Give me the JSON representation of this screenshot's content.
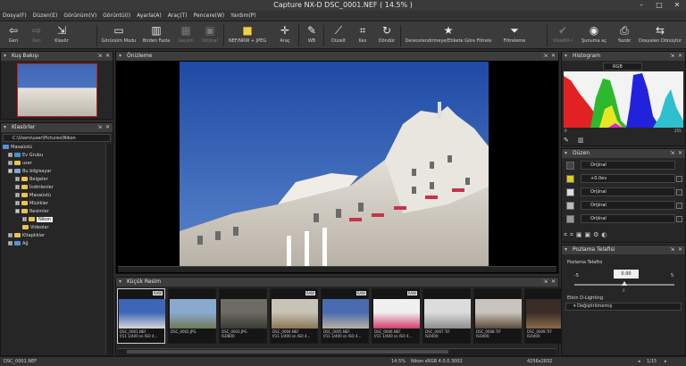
{
  "window": {
    "title": "Capture NX-D     DSC_0001.NEF ( 14.5% )"
  },
  "menu": [
    "Dosya(F)",
    "Düzen(E)",
    "Görünüm(V)",
    "Görüntü(I)",
    "Ayarla(A)",
    "Araç(T)",
    "Pencere(W)",
    "Yardım(P)"
  ],
  "toolbar": {
    "back": "Geri",
    "forward": "İleri",
    "browse": "Klasör",
    "view_mode": "Görünüm Modu",
    "multi": "Birden Fazla",
    "revert": "Geçerli",
    "original": "Orijinal",
    "nef_jpeg": "NEF/NRW + JPEG",
    "tool": "Araç",
    "wb": "WB",
    "straighten": "Düzelt",
    "crop": "Kes",
    "rotate": "Döndür",
    "rating_filter": "Derecelendirmeye/Etikete Göre Filtrele",
    "filter": "Filtreleme",
    "viewnx": "ViewNX-i",
    "surrounding": "Şunuma aç",
    "print": "Yazdır",
    "convert": "Dosyaları Dönüştür"
  },
  "overview": {
    "title": "Kuş Bakışı"
  },
  "folders": {
    "title": "Klasörler",
    "path": "C:\\Users\\user\\Pictures\\Nikon",
    "tree": [
      "Masaüstü",
      "Ev Grubu",
      "user",
      "Bu bilgisayar",
      "Belgeler",
      "İndirilenler",
      "Masaüstü",
      "Müzikler",
      "Resimler",
      "Nikon",
      "Videolar",
      "Kitaplıklar",
      "Ağ"
    ]
  },
  "viewer": {
    "title": "Önizleme"
  },
  "thumbnails": {
    "title": "Küçük Resim",
    "items": [
      {
        "name": "DSC_0001.NEF",
        "meta": "f/11 1/400 sn ISO 4...",
        "raw": "RAW",
        "colors": [
          "#3d66b8",
          "#d8d8d8"
        ]
      },
      {
        "name": "DSC_0002.JPG",
        "meta": "",
        "raw": "",
        "colors": [
          "#8aa9cf",
          "#6f7a58"
        ]
      },
      {
        "name": "DSC_0003.JPG",
        "meta": "ISO800",
        "raw": "",
        "colors": [
          "#6e6a64",
          "#3a3a38"
        ]
      },
      {
        "name": "DSC_0004.NEF",
        "meta": "f/11 1/400 sn ISO 4...",
        "raw": "RAW",
        "colors": [
          "#c7c3b6",
          "#8a7656"
        ]
      },
      {
        "name": "DSC_0005.NEF",
        "meta": "f/11 1/400 sn ISO 4...",
        "raw": "RAW",
        "colors": [
          "#4a6ab0",
          "#b9b0a2"
        ]
      },
      {
        "name": "DSC_0006.NEF",
        "meta": "f/11 1/400 sn ISO 4...",
        "raw": "RAW",
        "colors": [
          "#f0f0f0",
          "#d33c6a"
        ]
      },
      {
        "name": "DSC_0007.TIF",
        "meta": "ISO400",
        "raw": "",
        "colors": [
          "#dcdcdc",
          "#8d8d8d"
        ]
      },
      {
        "name": "DSC_0008.TIF",
        "meta": "ISO400",
        "raw": "",
        "colors": [
          "#c9c4bd",
          "#5a4a3a"
        ]
      },
      {
        "name": "DSC_0009.TIF",
        "meta": "ISO400",
        "raw": "",
        "colors": [
          "#3a2d26",
          "#8a6a48"
        ]
      }
    ]
  },
  "histogram": {
    "title": "Histogram",
    "channel": "RGB",
    "min": "0",
    "max": "255"
  },
  "adjustments": {
    "title": "Düzen",
    "rows": [
      {
        "icon": "gear-icon",
        "value": "Orijinal"
      },
      {
        "icon": "exposure-icon",
        "value": "+0.0ev"
      },
      {
        "icon": "wb-icon",
        "value": "Orijinal"
      },
      {
        "icon": "picture-control-icon",
        "value": "Orijinal"
      },
      {
        "icon": "lens-icon",
        "value": "Orijinal"
      }
    ]
  },
  "exposure": {
    "title": "Pozlama Telafisi",
    "label": "Pozlama Telafisi",
    "value": "0.00",
    "min": "-5",
    "mid": "0",
    "max": "5",
    "slider_fraction": 0.5,
    "d_lighting": "Etkin D-Lighting",
    "d_lighting_value": "Değiştirilmemiş"
  },
  "status": {
    "file": "DSC_0001.NEF",
    "zoom": "14.5%",
    "profile": "Nikon sRGB 4.0.0.3002",
    "size": "4256x2832",
    "page": "1/15"
  }
}
